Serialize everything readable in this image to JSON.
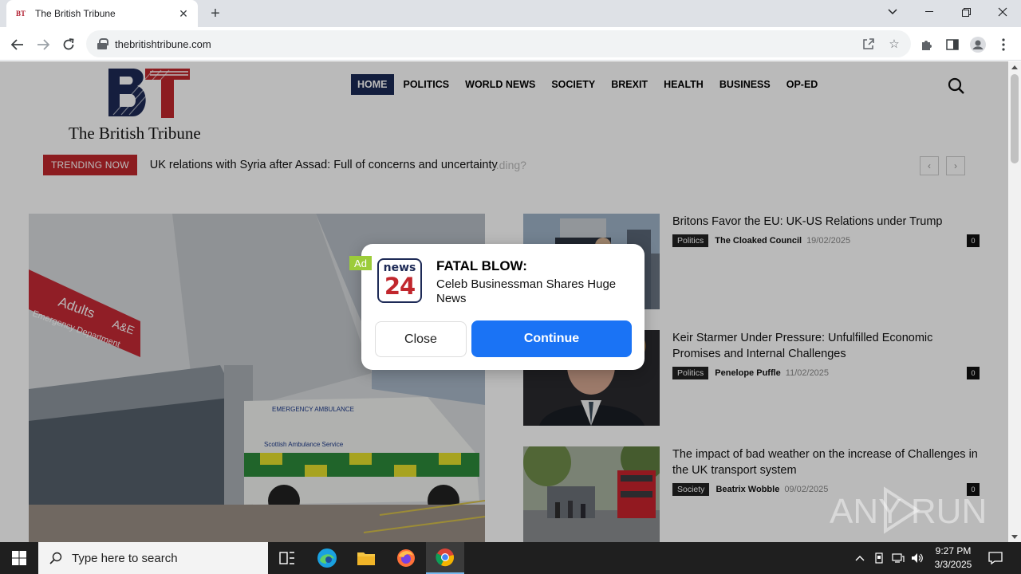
{
  "browser": {
    "tab_title": "The British Tribune",
    "tab_favicon_text": "BT",
    "url": "thebritishtribune.com"
  },
  "site": {
    "logo_text": "The British Tribune",
    "nav": [
      "HOME",
      "POLITICS",
      "WORLD NEWS",
      "SOCIETY",
      "BREXIT",
      "HEALTH",
      "BUSINESS",
      "OP-ED"
    ],
    "trending_label": "TRENDING NOW",
    "trending_headline": "UK relations with Syria after Assad: Full of concerns and uncertainty",
    "trending_ghost": "...ding?",
    "articles": [
      {
        "title": "Britons Favor the EU: UK-US Relations under Trump",
        "category": "Politics",
        "author": "The Cloaked Council",
        "date": "19/02/2025",
        "comments": "0"
      },
      {
        "title": "Keir Starmer Under Pressure: Unfulfilled Economic Promises and Internal Challenges",
        "category": "Politics",
        "author": "Penelope Puffle",
        "date": "11/02/2025",
        "comments": "0"
      },
      {
        "title": "The impact of bad weather on the increase of Challenges in the UK transport system",
        "category": "Society",
        "author": "Beatrix Wobble",
        "date": "09/02/2025",
        "comments": "0"
      }
    ],
    "hero_signs": {
      "adults": "Adults",
      "ae": "A&E",
      "emergency": "Emergency Department",
      "ambulance_top": "EMERGENCY AMBULANCE",
      "ambulance_side": "Scottish Ambulance Service"
    }
  },
  "ad": {
    "tag": "Ad",
    "logo_top": "news",
    "logo_num": "24",
    "headline": "FATAL BLOW:",
    "body": "Celeb Businessman Shares Huge News",
    "close_label": "Close",
    "continue_label": "Continue"
  },
  "watermark": "ANY RUN",
  "taskbar": {
    "search_placeholder": "Type here to search",
    "time": "9:27 PM",
    "date": "3/3/2025"
  },
  "colors": {
    "nav_active": "#1b2a55",
    "trend_badge": "#c1272d",
    "ad_continue": "#1a73f5",
    "ad_tag": "#9ccc3a"
  }
}
